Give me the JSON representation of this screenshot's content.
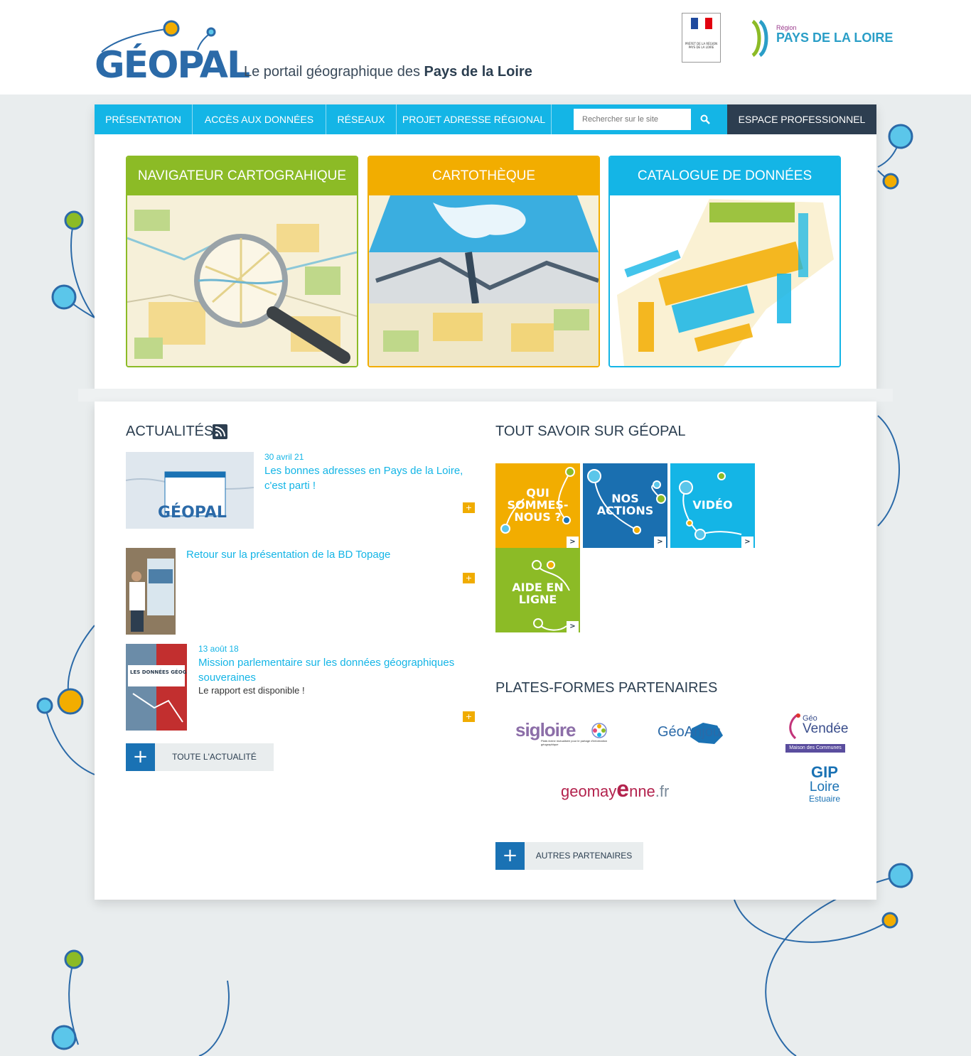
{
  "header": {
    "logo_text": "GÉOPAL",
    "tagline_prefix": "Le portail géographique des",
    "tagline_region": "Pays de la Loire",
    "prefet_text": "PRÉFET DE LA RÉGION PAYS DE LA LOIRE",
    "region_small": "Région",
    "region_big": "PAYS DE LA LOIRE"
  },
  "nav": {
    "items": [
      "Présentation",
      "Accès aux données",
      "Réseaux",
      "Projet Adresse Régional"
    ],
    "search_placeholder": "Rechercher sur le site",
    "espace": "Espace professionnel"
  },
  "cards": [
    {
      "title": "Navigateur cartograhique",
      "color": "#8cbb26"
    },
    {
      "title": "Cartothèque",
      "color": "#f2ad00"
    },
    {
      "title": "Catalogue de données",
      "color": "#14b5e6"
    }
  ],
  "news": {
    "title": "Actualités",
    "items": [
      {
        "date": "30 avril 21",
        "title": "Les bonnes adresses en Pays de la Loire, c'est parti !",
        "sub": ""
      },
      {
        "date": "",
        "title": "Retour sur la présentation de la BD Topage",
        "sub": ""
      },
      {
        "date": "13 août 18",
        "title": "Mission parlementaire sur les données géographiques souveraines",
        "sub": "Le rapport est disponible !"
      }
    ],
    "thumb1_logo": "GÉOPAL",
    "thumb3_text": "LES DONNÉES GÉOGRAPHIQUES SOUVERAINES",
    "more_plus": "+",
    "item_plus": "+",
    "more_label": "Toute l'actualité"
  },
  "about": {
    "title": "Tout savoir sur Géopal",
    "tiles": [
      {
        "label": "Qui sommes-nous ?",
        "color": "#f2ad00"
      },
      {
        "label": "Nos actions",
        "color": "#1a6fb0"
      },
      {
        "label": "Vidéo",
        "color": "#14b5e6"
      },
      {
        "label": "Aide en ligne",
        "color": "#8cbb26"
      }
    ],
    "tile_go": ">"
  },
  "partners": {
    "title": "Plates-formes partenaires",
    "sigloire": "sigloire",
    "sigloire_sub": "Plate-forme mutualisée pour le partage d'information géographique",
    "geoanjou": "GéoAnjou",
    "geovendee_top": "Géo",
    "geovendee_main": "Vendée",
    "geovendee_sub": "Maison des Communes",
    "geomayenne_a": "geomay",
    "geomayenne_e": "e",
    "geomayenne_b": "nne",
    "geomayenne_c": ".fr",
    "gip_1": "GIP",
    "gip_2": "Loire",
    "gip_3": "Estuaire",
    "more_plus": "+",
    "more_label": "Autres partenaires"
  },
  "colors": {
    "nav": "#14b5e6",
    "dark": "#2d3e50",
    "blue": "#1a72b4",
    "green": "#8cbb26",
    "orange": "#f2ad00"
  }
}
